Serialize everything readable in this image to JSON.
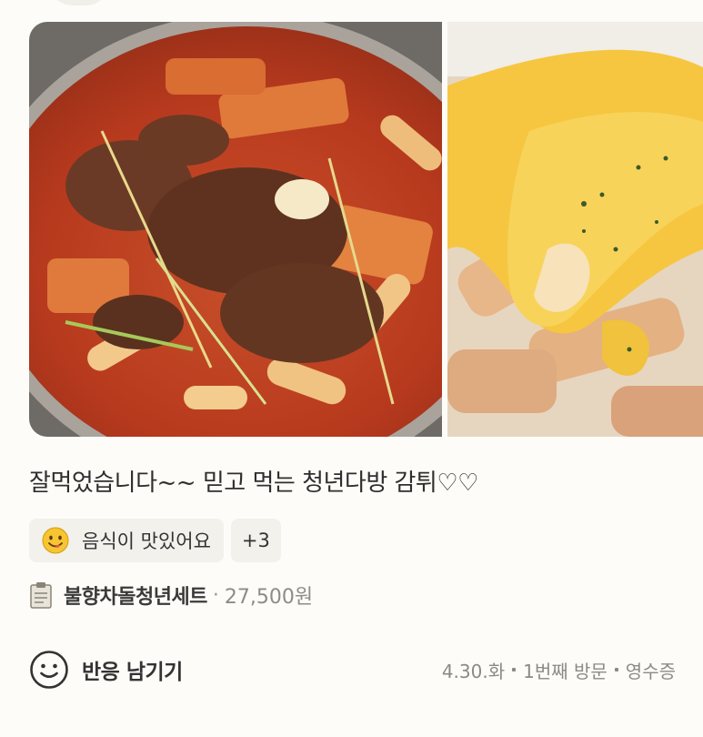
{
  "review": {
    "text": "잘먹었습니다~~ 믿고 먹는 청년다방 감튀♡♡"
  },
  "photos": [
    {
      "name": "tteokbokki-photo",
      "icon": "food-photo"
    },
    {
      "name": "cheese-fries-photo",
      "icon": "food-photo"
    }
  ],
  "tags": {
    "main_icon": "smiling-emoji-icon",
    "main_label": "음식이 맛있어요",
    "more_label": "+3"
  },
  "menu": {
    "icon": "clipboard-icon",
    "name": "불향차돌청년세트",
    "separator": "·",
    "price": "27,500원"
  },
  "actions": {
    "react_icon": "smile-icon",
    "react_label": "반응 남기기"
  },
  "visit_meta": {
    "date": "4.30.화",
    "visit": "1번째 방문",
    "proof": "영수증"
  },
  "colors": {
    "background": "#fdfcf8",
    "tag_bg": "#f3f1ec",
    "text_primary": "#2e2e2e",
    "text_muted": "#8a8a8a"
  }
}
